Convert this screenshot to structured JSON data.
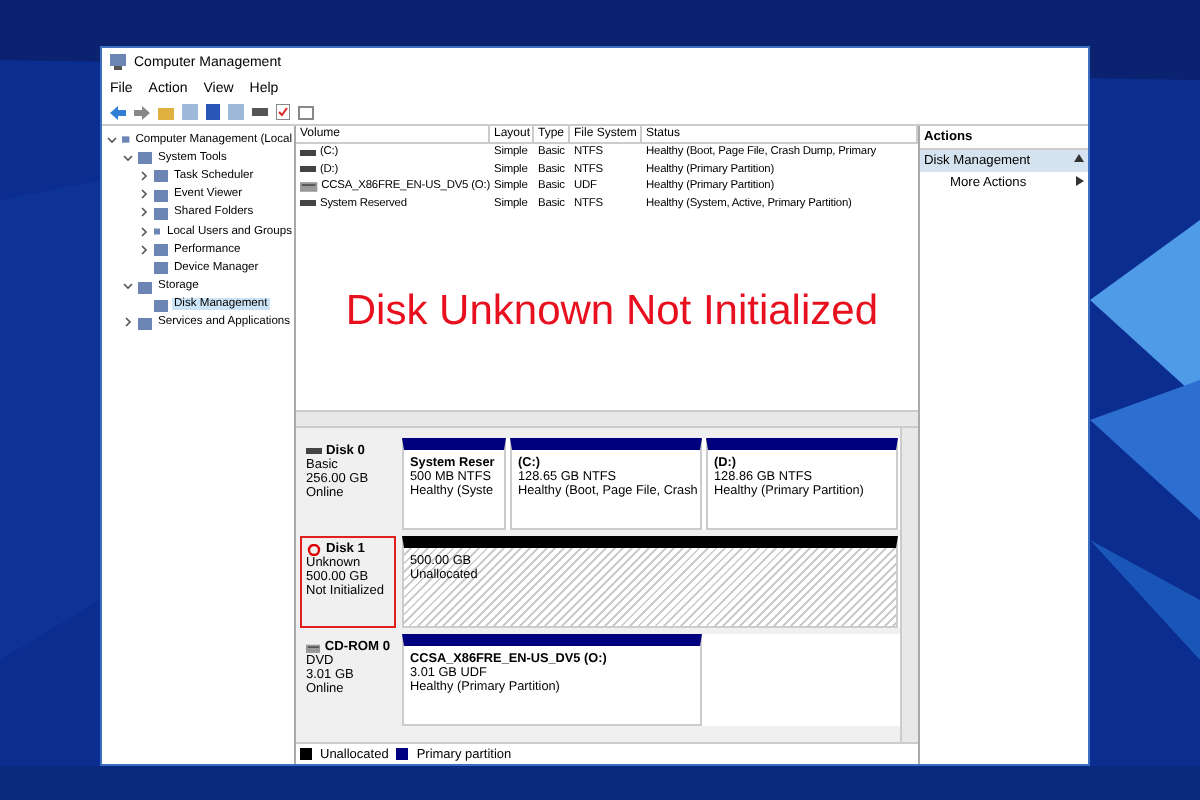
{
  "window": {
    "title": "Computer Management"
  },
  "menu": [
    "File",
    "Action",
    "View",
    "Help"
  ],
  "tree": [
    {
      "label": "Computer Management (Local",
      "expanded": true,
      "selected": false,
      "children": [
        {
          "label": "System Tools",
          "expanded": true,
          "selected": false,
          "children": [
            {
              "label": "Task Scheduler",
              "expanded": false,
              "selected": false
            },
            {
              "label": "Event Viewer",
              "expanded": false,
              "selected": false
            },
            {
              "label": "Shared Folders",
              "expanded": false,
              "selected": false
            },
            {
              "label": "Local Users and Groups",
              "expanded": false,
              "selected": false
            },
            {
              "label": "Performance",
              "expanded": false,
              "selected": false
            },
            {
              "label": "Device Manager",
              "selected": false
            }
          ]
        },
        {
          "label": "Storage",
          "expanded": true,
          "selected": false,
          "children": [
            {
              "label": "Disk Management",
              "selected": true
            }
          ]
        },
        {
          "label": "Services and Applications",
          "expanded": false,
          "selected": false
        }
      ]
    }
  ],
  "volumes": {
    "columns": [
      "Volume",
      "Layout",
      "Type",
      "File System",
      "Status"
    ],
    "rows": [
      {
        "kind": "disk",
        "cells": [
          "(C:)",
          "Simple",
          "Basic",
          "NTFS",
          "Healthy (Boot, Page File, Crash Dump, Primary"
        ]
      },
      {
        "kind": "disk",
        "cells": [
          "(D:)",
          "Simple",
          "Basic",
          "NTFS",
          "Healthy (Primary Partition)"
        ]
      },
      {
        "kind": "cdrom",
        "cells": [
          "CCSA_X86FRE_EN-US_DV5 (O:)",
          "Simple",
          "Basic",
          "UDF",
          "Healthy (Primary Partition)"
        ]
      },
      {
        "kind": "disk",
        "cells": [
          "System Reserved",
          "Simple",
          "Basic",
          "NTFS",
          "Healthy (System, Active, Primary Partition)"
        ]
      }
    ]
  },
  "annotation": "Disk Unknown Not Initialized",
  "disks": [
    {
      "kind": "disk",
      "highlighted": false,
      "name": "Disk 0",
      "lines": [
        "Basic",
        "256.00 GB",
        "Online"
      ],
      "partitions": [
        {
          "kind": "primary",
          "title": "System Reser",
          "lines": [
            "500 MB NTFS",
            "Healthy (Syste"
          ]
        },
        {
          "kind": "primary",
          "title": "(C:)",
          "lines": [
            "128.65 GB NTFS",
            "Healthy (Boot, Page File, Crash"
          ]
        },
        {
          "kind": "primary",
          "title": "(D:)",
          "lines": [
            "128.86 GB NTFS",
            "Healthy (Primary Partition)"
          ]
        }
      ]
    },
    {
      "kind": "error",
      "highlighted": true,
      "name": "Disk 1",
      "lines": [
        "Unknown",
        "500.00 GB",
        "Not Initialized"
      ],
      "partitions": [
        {
          "kind": "unallocated",
          "lines": [
            "500.00 GB",
            "Unallocated"
          ]
        }
      ]
    },
    {
      "kind": "cdrom",
      "highlighted": false,
      "name": "CD-ROM 0",
      "lines": [
        "DVD",
        "3.01 GB",
        "Online"
      ],
      "partitions": [
        {
          "kind": "primary",
          "title": "CCSA_X86FRE_EN-US_DV5  (O:)",
          "lines": [
            "3.01 GB UDF",
            "Healthy (Primary Partition)"
          ]
        }
      ]
    }
  ],
  "legend": [
    {
      "label": "Unallocated",
      "color": "#000000"
    },
    {
      "label": "Primary partition",
      "color": "#000080"
    }
  ],
  "actions": {
    "title": "Actions",
    "section": "Disk Management",
    "items": [
      "More Actions"
    ]
  }
}
